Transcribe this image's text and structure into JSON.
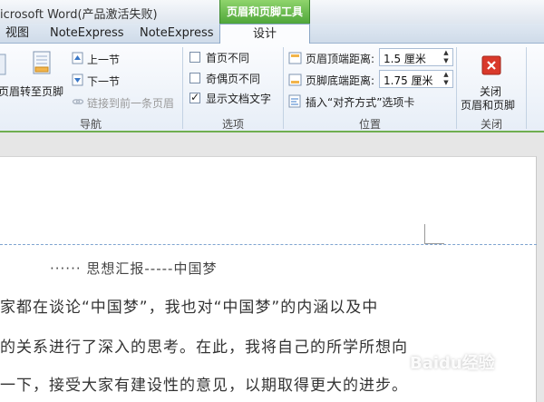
{
  "window": {
    "title": "icrosoft Word(产品激活失败)",
    "contextual_tool": "页眉和页脚工具"
  },
  "tabs": [
    {
      "label": "视图"
    },
    {
      "label": "NoteExpress"
    },
    {
      "label": "NoteExpress"
    },
    {
      "label": "设计",
      "active": true
    }
  ],
  "ribbon": {
    "navigation": {
      "cut_label": "页眉",
      "goto_footer": "转至页脚",
      "prev_section": "上一节",
      "next_section": "下一节",
      "link_previous": "链接到前一条页眉",
      "group_label": "导航"
    },
    "options": {
      "different_first": "首页不同",
      "different_odd_even": "奇偶页不同",
      "show_doc_text": "显示文档文字",
      "different_first_checked": false,
      "different_odd_even_checked": false,
      "show_doc_text_checked": true,
      "group_label": "选项"
    },
    "position": {
      "header_top_label": "页眉顶端距离:",
      "header_top_value": "1.5 厘米",
      "footer_bottom_label": "页脚底端距离:",
      "footer_bottom_value": "1.75 厘米",
      "insert_align_tab": "插入“对齐方式”选项卡",
      "group_label": "位置"
    },
    "close": {
      "line1": "关闭",
      "line2": "页眉和页脚",
      "group_label": "关闭"
    }
  },
  "document": {
    "header_title": "······ 思想汇报-----中国梦",
    "lines": [
      "家都在谈论“中国梦”，我也对“中国梦”的内涵以及中",
      "的关系进行了深入的思考。在此，我将自己的所学所想向",
      "一下，接受大家有建设性的意见，以期取得更大的进步。"
    ]
  },
  "watermark": "Baidu经验",
  "colors": {
    "tool_green": "#4fa63a",
    "ribbon_accent": "#6fae4f",
    "header_dash": "#7fa4d0",
    "close_red": "#d9392b"
  }
}
